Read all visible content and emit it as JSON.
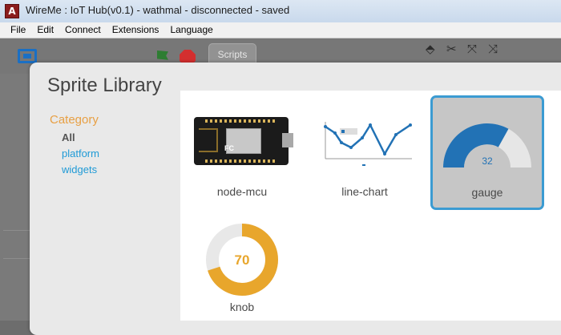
{
  "window": {
    "title": "WireMe : IoT Hub(v0.1) - wathmal - disconnected - saved",
    "app_icon_letter": "A"
  },
  "menubar": [
    "File",
    "Edit",
    "Connect",
    "Extensions",
    "Language"
  ],
  "toolbar": {
    "scripts_tab": "Scripts"
  },
  "dialog": {
    "title": "Sprite Library",
    "category_title": "Category",
    "categories": [
      {
        "label": "All",
        "selected": true
      },
      {
        "label": "platform",
        "selected": false
      },
      {
        "label": "widgets",
        "selected": false
      }
    ],
    "sprites": [
      {
        "label": "node-mcu",
        "selected": false
      },
      {
        "label": "line-chart",
        "selected": false
      },
      {
        "label": "gauge",
        "selected": true,
        "value": "32"
      },
      {
        "label": "knob",
        "selected": false,
        "value": "70"
      }
    ]
  },
  "colors": {
    "accent": "#3b9bd2",
    "gauge": "#2272b5",
    "knob": "#e8a62c",
    "category": "#e8a044",
    "link": "#1f9ad6"
  }
}
